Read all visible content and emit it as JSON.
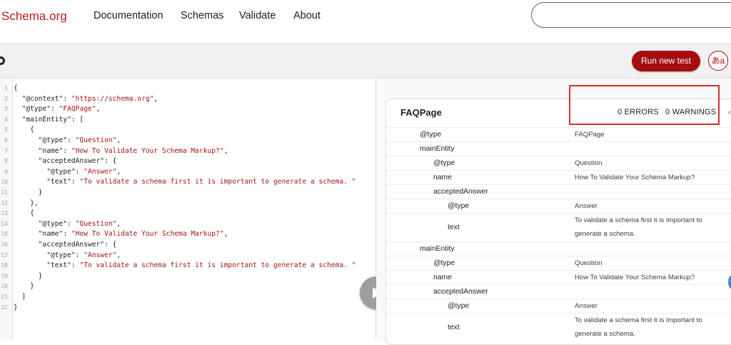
{
  "nav": {
    "logo": "Schema.org",
    "links": [
      "Documentation",
      "Schemas",
      "Validate",
      "About"
    ],
    "search_placeholder": ""
  },
  "toolbar": {
    "run_label": "Run new test",
    "lang_label": "あa"
  },
  "editor": {
    "lines": [
      {
        "n": "1",
        "text": "{"
      },
      {
        "n": "2",
        "text": "  \"@context\": \"https://schema.org\","
      },
      {
        "n": "3",
        "text": "  \"@type\": \"FAQPage\","
      },
      {
        "n": "4",
        "text": "  \"mainEntity\": ["
      },
      {
        "n": "5",
        "text": "    {"
      },
      {
        "n": "6",
        "text": "      \"@type\": \"Question\","
      },
      {
        "n": "7",
        "text": "      \"name\": \"How To Validate Your Schema Markup?\","
      },
      {
        "n": "8",
        "text": "      \"acceptedAnswer\": {"
      },
      {
        "n": "9",
        "text": "        \"@type\": \"Answer\","
      },
      {
        "n": "10",
        "text": "        \"text\": \"To validate a schema first it is important to generate a schema. \""
      },
      {
        "n": "11",
        "text": "      }"
      },
      {
        "n": "12",
        "text": "    },"
      },
      {
        "n": "13",
        "text": "    {"
      },
      {
        "n": "14",
        "text": "      \"@type\": \"Question\","
      },
      {
        "n": "15",
        "text": "      \"name\": \"How To Validate Your Schema Markup?\","
      },
      {
        "n": "16",
        "text": "      \"acceptedAnswer\": {"
      },
      {
        "n": "17",
        "text": "        \"@type\": \"Answer\","
      },
      {
        "n": "18",
        "text": "        \"text\": \"To validate a schema first it is important to generate a schema. \""
      },
      {
        "n": "19",
        "text": "      }"
      },
      {
        "n": "20",
        "text": "    }"
      },
      {
        "n": "21",
        "text": "  ]"
      },
      {
        "n": "22",
        "text": "}"
      }
    ]
  },
  "results": {
    "title": "FAQPage",
    "errors": "0 ERRORS",
    "warnings": "0 WARNINGS",
    "rows": [
      {
        "key": "@type",
        "depth": 0,
        "value": "FAQPage"
      },
      {
        "key": "mainEntity",
        "depth": 0,
        "value": ""
      },
      {
        "key": "@type",
        "depth": 1,
        "value": "Question"
      },
      {
        "key": "name",
        "depth": 1,
        "value": "How To Validate Your Schema Markup?"
      },
      {
        "key": "acceptedAnswer",
        "depth": 1,
        "value": ""
      },
      {
        "key": "@type",
        "depth": 2,
        "value": "Answer"
      },
      {
        "key": "text",
        "depth": 2,
        "value": "To validate a schema first it is important to generate a schema.",
        "tall": true
      },
      {
        "key": "mainEntity",
        "depth": 0,
        "value": ""
      },
      {
        "key": "@type",
        "depth": 1,
        "value": "Question"
      },
      {
        "key": "name",
        "depth": 1,
        "value": "How To Validate Your Schema Markup?"
      },
      {
        "key": "acceptedAnswer",
        "depth": 1,
        "value": ""
      },
      {
        "key": "@type",
        "depth": 2,
        "value": "Answer"
      },
      {
        "key": "text",
        "depth": 2,
        "value": "To validate a schema first it is important to generate a schema.",
        "tall": true
      }
    ]
  },
  "colors": {
    "brand": "#a50e0e",
    "highlight": "#d32f2f",
    "string": "#a31515"
  }
}
